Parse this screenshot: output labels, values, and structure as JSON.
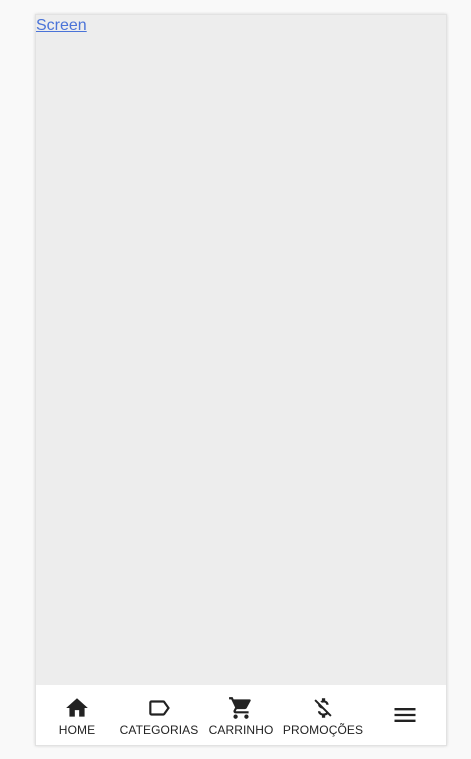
{
  "screen_link": "Screen",
  "bottom_nav": {
    "items": [
      {
        "label": "HOME",
        "icon": "home-icon"
      },
      {
        "label": "CATEGORIAS",
        "icon": "label-tag-icon"
      },
      {
        "label": "CARRINHO",
        "icon": "shopping-cart-icon"
      },
      {
        "label": "PROMOÇÕES",
        "icon": "money-off-icon"
      },
      {
        "label": "",
        "icon": "menu-icon"
      }
    ]
  },
  "colors": {
    "content_background": "#ededed",
    "nav_background": "#ffffff",
    "link": "#4a73d8",
    "icon": "#222222"
  }
}
